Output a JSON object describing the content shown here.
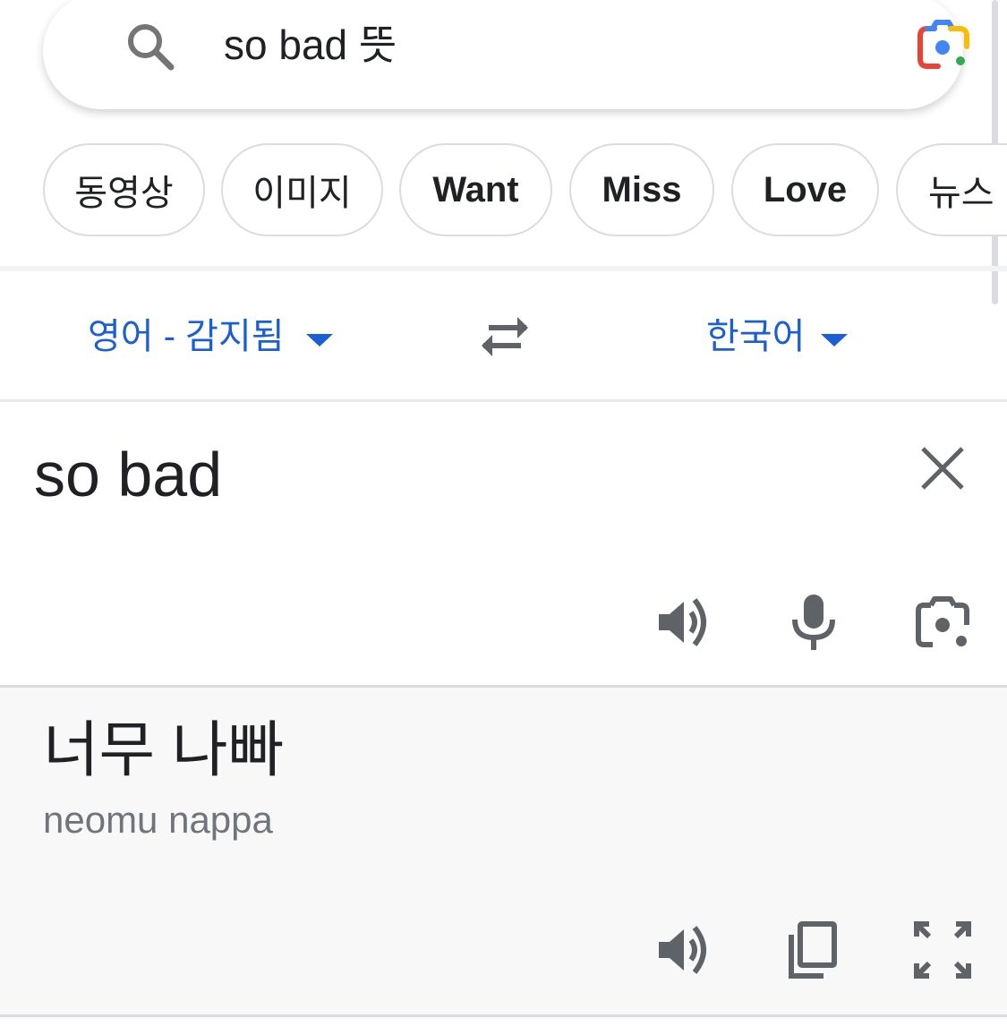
{
  "search": {
    "query": "so bad 뜻"
  },
  "chips": [
    {
      "label": "동영상"
    },
    {
      "label": "이미지"
    },
    {
      "label": "Want"
    },
    {
      "label": "Miss"
    },
    {
      "label": "Love"
    },
    {
      "label": "뉴스"
    }
  ],
  "translator": {
    "source_language": "영어 - 감지됨",
    "target_language": "한국어",
    "source_text": "so bad",
    "translated_text": "너무 나빠",
    "transliteration": "neomu nappa"
  },
  "icons": {
    "search": "search-icon",
    "lens": "google-lens-icon",
    "swap": "swap-languages-icon",
    "clear": "close-icon",
    "listen_source": "speaker-icon",
    "microphone": "microphone-icon",
    "camera": "camera-icon",
    "listen_target": "speaker-icon",
    "copy": "copy-icon",
    "fullscreen": "fullscreen-icon"
  },
  "colors": {
    "accent": "#1a5fd4",
    "icon_gray": "#5f6368",
    "text": "#202124",
    "secondary_text": "#70757a",
    "panel_bg": "#f8f8f8"
  }
}
